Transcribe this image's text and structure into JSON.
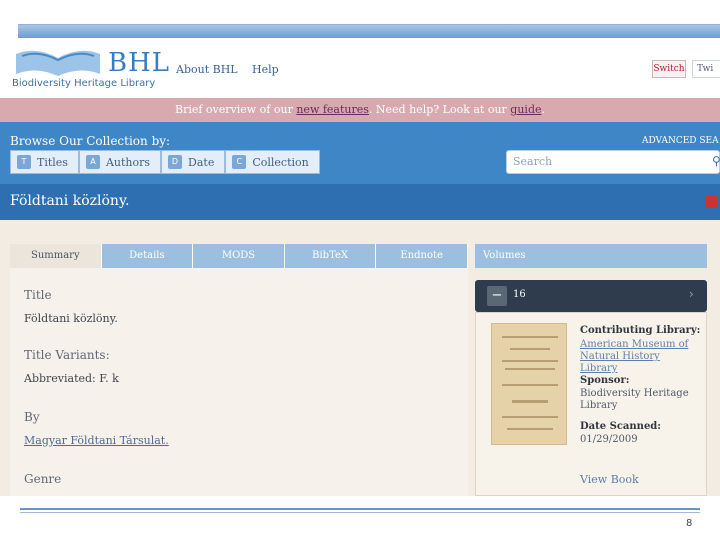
{
  "header": {
    "logo_text": "BHL",
    "logo_subtitle": "Biodiversity Heritage Library",
    "nav": [
      "About BHL",
      "Help"
    ],
    "switch_label": "Switch",
    "twitter_label": "Twi"
  },
  "notice": {
    "pre": "Brief overview of our ",
    "link1": "new features",
    "mid": ". Need help? Look at our ",
    "link2": "guide",
    "post": "."
  },
  "browse": {
    "label": "Browse Our Collection by:",
    "tabs": [
      "Titles",
      "Authors",
      "Date",
      "Collection"
    ],
    "advanced": "ADVANCED SEA",
    "search_placeholder": "Search"
  },
  "title_bar": "Földtani közlöny.",
  "tabs": [
    "Summary",
    "Details",
    "MODS",
    "BibTeX",
    "Endnote"
  ],
  "summary": {
    "title_label": "Title",
    "title_value": "Földtani közlöny.",
    "variants_label": "Title Variants:",
    "variants_value": "Abbreviated: F. k",
    "by_label": "By",
    "by_value": "Magyar Földtani Társulat.",
    "genre_label": "Genre"
  },
  "volumes": {
    "header": "Volumes",
    "selected": "16",
    "contributing_label": "Contributing Library:",
    "contributing_value": "American Museum of Natural History Library",
    "sponsor_label": "Sponsor:",
    "sponsor_value": "Biodiversity Heritage Library",
    "scanned_label": "Date Scanned:",
    "scanned_value": "01/29/2009",
    "view_book": "View Book"
  },
  "page_number": "8"
}
